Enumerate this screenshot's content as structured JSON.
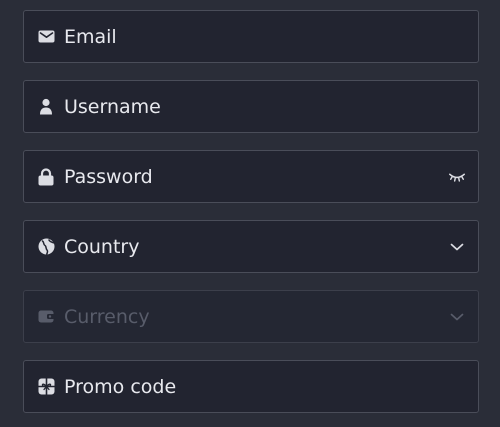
{
  "colors": {
    "background": "#2a2d38",
    "field_background": "#222430",
    "field_border": "#4a4d59",
    "text": "#e8e9ee",
    "icon": "#dcdde3",
    "disabled_text": "#585c6a"
  },
  "fields": [
    {
      "label": "Email",
      "icon": "envelope-icon"
    },
    {
      "label": "Username",
      "icon": "user-icon"
    },
    {
      "label": "Password",
      "icon": "lock-icon",
      "trailing_icon": "eye-closed-icon"
    },
    {
      "label": "Country",
      "icon": "globe-icon",
      "trailing_icon": "chevron-down-icon"
    },
    {
      "label": "Currency",
      "icon": "wallet-icon",
      "trailing_icon": "chevron-down-icon",
      "disabled": true
    },
    {
      "label": "Promo code",
      "icon": "gift-icon"
    }
  ]
}
